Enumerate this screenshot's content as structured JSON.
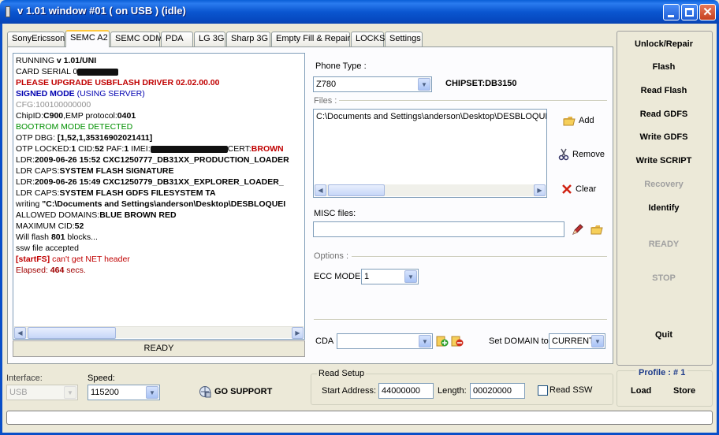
{
  "window": {
    "title": "v 1.01 window #01 ( on USB ) (idle)",
    "controls": {
      "minimize": "minimize-icon",
      "maximize": "maximize-icon",
      "close": "close-icon"
    }
  },
  "tabs": [
    {
      "label": "SonyEricsson",
      "active": false
    },
    {
      "label": "SEMC A2",
      "active": true
    },
    {
      "label": "SEMC ODM",
      "active": false
    },
    {
      "label": "PDA",
      "active": false
    },
    {
      "label": "LG 3G",
      "active": false
    },
    {
      "label": "Sharp 3G",
      "active": false
    },
    {
      "label": "Empty Fill & Repair",
      "active": false
    },
    {
      "label": "LOCKS",
      "active": false
    },
    {
      "label": "Settings",
      "active": false
    }
  ],
  "log": {
    "lines": [
      [
        {
          "t": "RUNNING ",
          "c": "black"
        },
        {
          "t": "v 1.01/UNI",
          "c": "black",
          "b": true
        }
      ],
      [
        {
          "t": "CARD SERIAL ",
          "c": "black"
        },
        {
          "t": "0",
          "c": "black"
        },
        {
          "redact": 52
        }
      ],
      [
        {
          "t": "PLEASE UPGRADE USBFLASH DRIVER 02.02.00.00",
          "c": "red",
          "b": true
        }
      ],
      [
        {
          "t": "SIGNED MODE",
          "c": "blue",
          "b": true
        },
        {
          "t": " (USING SERVER)",
          "c": "blue"
        }
      ],
      [
        {
          "t": "CFG:",
          "c": "gray"
        },
        {
          "t": "100100000000",
          "c": "gray"
        }
      ],
      [
        {
          "t": "ChipID:",
          "c": "black"
        },
        {
          "t": "C900",
          "c": "black",
          "b": true
        },
        {
          "t": ",EMP protocol:",
          "c": "black"
        },
        {
          "t": "0401",
          "c": "black",
          "b": true
        }
      ],
      [
        {
          "t": "BOOTROM MODE DETECTED",
          "c": "green"
        }
      ],
      [
        {
          "t": "OTP DBG: ",
          "c": "black"
        },
        {
          "t": "[1,52,1,35316902021411]",
          "c": "black",
          "b": true
        }
      ],
      [
        {
          "t": "OTP LOCKED:",
          "c": "black"
        },
        {
          "t": "1",
          "c": "black",
          "b": true
        },
        {
          "t": " CID:",
          "c": "black"
        },
        {
          "t": "52",
          "c": "black",
          "b": true
        },
        {
          "t": " PAF:",
          "c": "black"
        },
        {
          "t": "1",
          "c": "black",
          "b": true
        },
        {
          "t": " IMEI:",
          "c": "black"
        },
        {
          "redact": 98
        },
        {
          "t": "CERT:",
          "c": "black"
        },
        {
          "t": "BROWN",
          "c": "red",
          "b": true
        }
      ],
      [
        {
          "t": "LDR:",
          "c": "black"
        },
        {
          "t": "2009-06-26 15:52 CXC1250777_DB31XX_PRODUCTION_LOADER",
          "c": "black",
          "b": true
        }
      ],
      [
        {
          "t": "LDR CAPS:",
          "c": "black"
        },
        {
          "t": "SYSTEM FLASH SIGNATURE",
          "c": "black",
          "b": true
        }
      ],
      [
        {
          "t": "LDR:",
          "c": "black"
        },
        {
          "t": "2009-06-26 15:49 CXC1250779_DB31XX_EXPLORER_LOADER_",
          "c": "black",
          "b": true
        }
      ],
      [
        {
          "t": "LDR CAPS:",
          "c": "black"
        },
        {
          "t": "SYSTEM FLASH GDFS FILESYSTEM TA",
          "c": "black",
          "b": true
        }
      ],
      [
        {
          "t": "writing ",
          "c": "black"
        },
        {
          "t": "\"C:\\Documents and Settings\\anderson\\Desktop\\DESBLOQUEI",
          "c": "black",
          "b": true
        }
      ],
      [
        {
          "t": "ALLOWED DOMAINS:",
          "c": "black"
        },
        {
          "t": "BLUE BROWN RED",
          "c": "black",
          "b": true
        }
      ],
      [
        {
          "t": "MAXIMUM CID:",
          "c": "black"
        },
        {
          "t": "52",
          "c": "black",
          "b": true
        }
      ],
      [
        {
          "t": "Will flash ",
          "c": "black"
        },
        {
          "t": "801",
          "c": "black",
          "b": true
        },
        {
          "t": " blocks...",
          "c": "black"
        }
      ],
      [
        {
          "t": "ssw file accepted",
          "c": "black"
        }
      ],
      [
        {
          "t": "[startFS]",
          "c": "red",
          "b": true
        },
        {
          "t": " can't get NET header",
          "c": "red"
        }
      ],
      [
        {
          "t": "Elapsed: ",
          "c": "darkred"
        },
        {
          "t": "464",
          "c": "darkred",
          "b": true
        },
        {
          "t": " secs.",
          "c": "darkred"
        }
      ]
    ],
    "status": "READY"
  },
  "phone": {
    "type_label": "Phone Type :",
    "type_value": "Z780",
    "chipset": "CHIPSET:DB3150"
  },
  "files": {
    "title": "Files :",
    "entry": "C:\\Documents and Settings\\anderson\\Desktop\\DESBLOQUEI",
    "add_label": "Add",
    "remove_label": "Remove",
    "clear_label": "Clear",
    "add_icon": "folder-open-icon",
    "remove_icon": "scissors-icon",
    "clear_icon": "red-x-icon"
  },
  "misc": {
    "label": "MISC files:",
    "value": "",
    "edit_icon": "pencil-icon",
    "browse_icon": "folder-open-icon"
  },
  "options": {
    "title": "Options :",
    "ecc_label": "ECC MODE",
    "ecc_value": "1"
  },
  "cda": {
    "label": "CDA",
    "value": "",
    "add_icon": "add-icon",
    "remove_icon": "remove-icon",
    "domain_label": "Set DOMAIN to",
    "domain_value": "CURRENT"
  },
  "commands": {
    "unlock": "Unlock/Repair",
    "flash": "Flash",
    "read_flash": "Read Flash",
    "read_gdfs": "Read GDFS",
    "write_gdfs": "Write GDFS",
    "write_script": "Write SCRIPT",
    "recovery": "Recovery",
    "identify": "Identify",
    "ready": "READY",
    "stop": "STOP",
    "quit": "Quit"
  },
  "interface": {
    "label": "Interface:",
    "value": "USB",
    "speed_label": "Speed:",
    "speed_value": "115200",
    "go_support": "GO SUPPORT"
  },
  "read_setup": {
    "title": "Read Setup",
    "start_label": "Start Address:",
    "start_value": "44000000",
    "length_label": "Length:",
    "length_value": "00020000",
    "ssw_label": "Read SSW",
    "ssw_checked": false
  },
  "profile": {
    "label": "Profile :",
    "number": "# 1",
    "load": "Load",
    "store": "Store"
  },
  "progress": {
    "value": 0
  },
  "colors": {
    "accent": "#0a56d0",
    "selected_tab": "#ffc83c",
    "error": "#c00000",
    "link_blue": "#0000b0",
    "ok_green": "#009000"
  }
}
